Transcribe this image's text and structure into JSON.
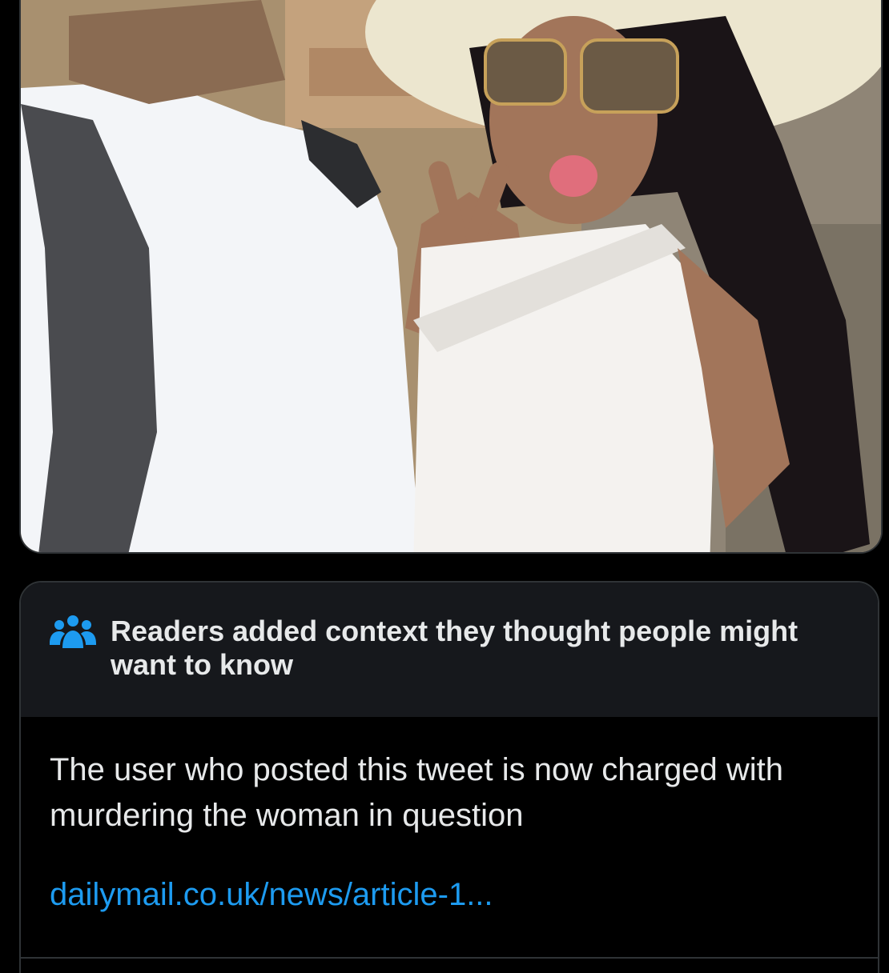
{
  "media": {
    "image_icon": "selfie-photo"
  },
  "note": {
    "icon": "people-icon",
    "title": "Readers added context they thought people might want to know",
    "body": "The user who posted this tweet is now charged with murdering the woman in question",
    "link": "dailymail.co.uk/news/article-1..."
  },
  "colors": {
    "background": "#000000",
    "card_border": "#2f3336",
    "note_header_bg": "#16181c",
    "text_primary": "#e7e9ea",
    "link": "#1d9bf0"
  }
}
